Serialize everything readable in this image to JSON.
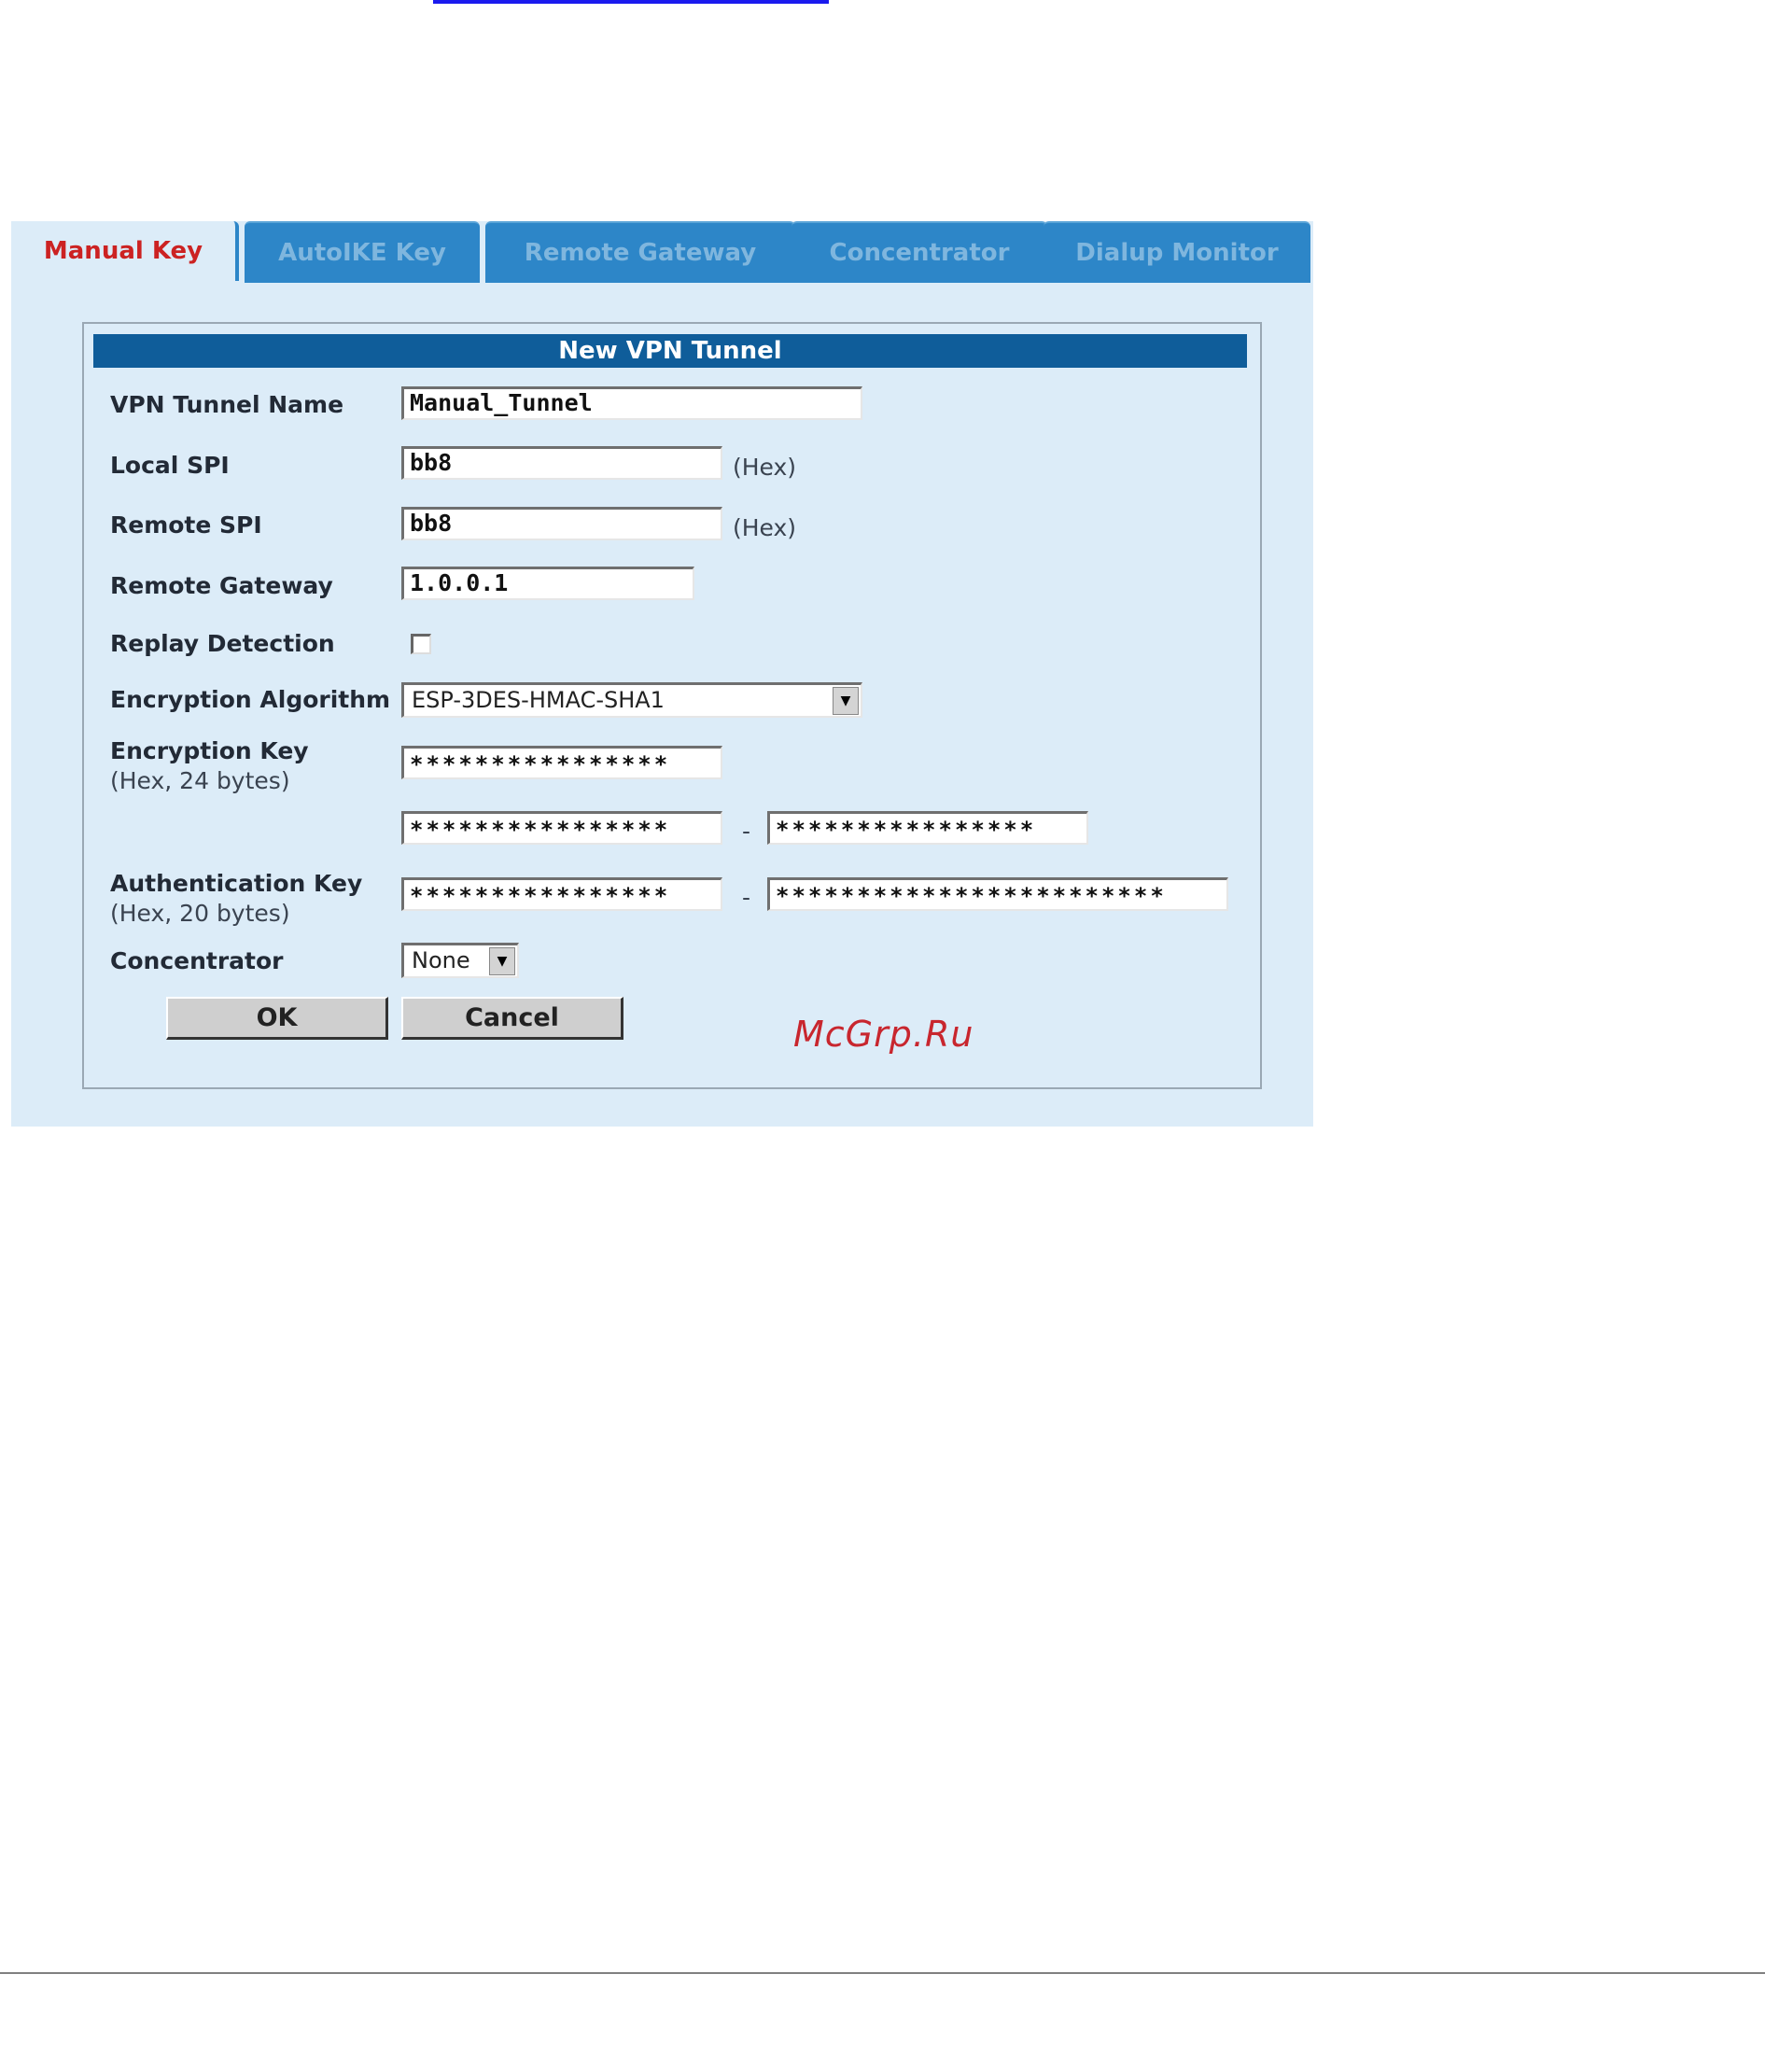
{
  "tabs": [
    {
      "label": "Manual Key",
      "active": true
    },
    {
      "label": "AutoIKE Key",
      "active": false
    },
    {
      "label": "Remote Gateway",
      "active": false
    },
    {
      "label": "Concentrator",
      "active": false
    },
    {
      "label": "Dialup Monitor",
      "active": false
    }
  ],
  "form": {
    "title": "New VPN Tunnel",
    "tunnel_name": {
      "label": "VPN Tunnel Name",
      "value": "Manual_Tunnel"
    },
    "local_spi": {
      "label": "Local SPI",
      "value": "bb8",
      "unit": "(Hex)"
    },
    "remote_spi": {
      "label": "Remote SPI",
      "value": "bb8",
      "unit": "(Hex)"
    },
    "remote_gateway": {
      "label": "Remote Gateway",
      "value": "1.0.0.1"
    },
    "replay_detection": {
      "label": "Replay Detection",
      "checked": false
    },
    "encryption_algorithm": {
      "label": "Encryption Algorithm",
      "value": "ESP-3DES-HMAC-SHA1"
    },
    "encryption_key": {
      "label": "Encryption Key",
      "hint": "(Hex, 24 bytes)",
      "part1": "****************",
      "part2": "****************",
      "part3": "****************",
      "separator": "-"
    },
    "authentication_key": {
      "label": "Authentication Key",
      "hint": "(Hex, 20 bytes)",
      "part1": "****************",
      "part2": "************************",
      "separator": "-"
    },
    "concentrator": {
      "label": "Concentrator",
      "value": "None"
    },
    "ok_label": "OK",
    "cancel_label": "Cancel"
  },
  "watermark": "McGrp.Ru",
  "colors": {
    "panel_bg": "#dcecf8",
    "tab_inactive": "#2d86c8",
    "header_bar": "#0f5d9a",
    "active_tab_text": "#cc2222"
  }
}
